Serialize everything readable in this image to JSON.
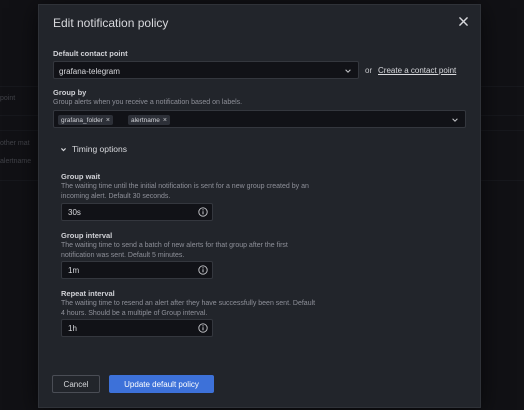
{
  "background": {
    "texts": [
      "point",
      "other mat",
      "alertname"
    ]
  },
  "modal": {
    "title": "Edit notification policy",
    "close_icon": "close-icon"
  },
  "contact_point": {
    "label": "Default contact point",
    "value": "grafana-telegram",
    "or_text": "or",
    "create_link": "Create a contact point"
  },
  "group_by": {
    "label": "Group by",
    "description": "Group alerts when you receive a notification based on labels.",
    "chips": [
      {
        "label": "grafana_folder",
        "remove": "×"
      },
      {
        "label": "alertname",
        "remove": "×"
      }
    ]
  },
  "timing": {
    "toggle_label": "Timing options",
    "fields": [
      {
        "label": "Group wait",
        "description_lines": [
          "The waiting time until the initial notification is sent for a new group created by an",
          "incoming alert. Default 30 seconds."
        ],
        "value": "30s"
      },
      {
        "label": "Group interval",
        "description_lines": [
          "The waiting time to send a batch of new alerts for that group after the first",
          "notification was sent. Default 5 minutes."
        ],
        "value": "1m"
      },
      {
        "label": "Repeat interval",
        "description_lines": [
          "The waiting time to resend an alert after they have successfully been sent. Default",
          "4 hours. Should be a multiple of Group interval."
        ],
        "value": "1h"
      }
    ]
  },
  "footer": {
    "cancel_label": "Cancel",
    "submit_label": "Update default policy"
  },
  "colors": {
    "primary": "#3d71d9",
    "modal_bg": "#22252b",
    "input_bg": "#111217"
  }
}
